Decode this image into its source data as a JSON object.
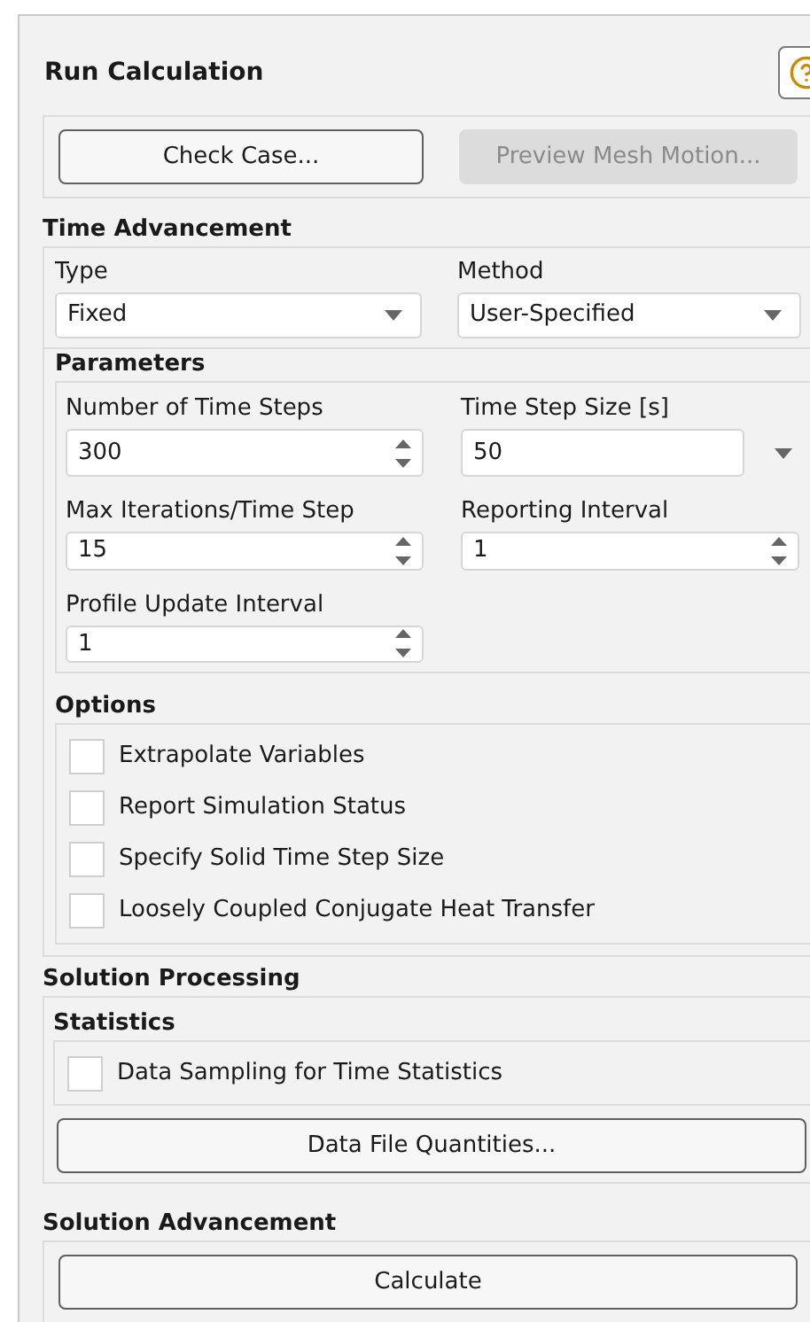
{
  "title": "Run Calculation",
  "top_buttons": [
    {
      "label": "Check Case...",
      "disabled": false
    },
    {
      "label": "Preview Mesh Motion...",
      "disabled": true
    }
  ],
  "time_advancement": {
    "title": "Time Advancement",
    "fields": [
      {
        "label": "Type",
        "value": "Fixed"
      },
      {
        "label": "Method",
        "value": "User-Specified"
      }
    ]
  },
  "parameters": {
    "title": "Parameters",
    "fields": [
      {
        "label": "Number of Time Steps",
        "value": "300",
        "kind": "spinner"
      },
      {
        "label": "Time Step Size [s]",
        "value": "50",
        "kind": "units"
      },
      {
        "label": "Max Iterations/Time Step",
        "value": "15",
        "kind": "spinner"
      },
      {
        "label": "Reporting Interval",
        "value": "1",
        "kind": "spinner"
      },
      {
        "label": "Profile Update Interval",
        "value": "1",
        "kind": "spinner"
      }
    ]
  },
  "options": {
    "title": "Options",
    "items": [
      {
        "label": "Extrapolate Variables",
        "checked": false
      },
      {
        "label": "Report Simulation Status",
        "checked": false
      },
      {
        "label": "Specify Solid Time Step Size",
        "checked": false
      },
      {
        "label": "Loosely Coupled Conjugate Heat Transfer",
        "checked": false
      }
    ]
  },
  "solution_processing": {
    "title": "Solution Processing",
    "statistics": {
      "title": "Statistics",
      "items": [
        {
          "label": "Data Sampling for Time Statistics",
          "checked": false
        }
      ]
    },
    "button": "Data File Quantities..."
  },
  "solution_advancement": {
    "title": "Solution Advancement",
    "button": "Calculate"
  }
}
